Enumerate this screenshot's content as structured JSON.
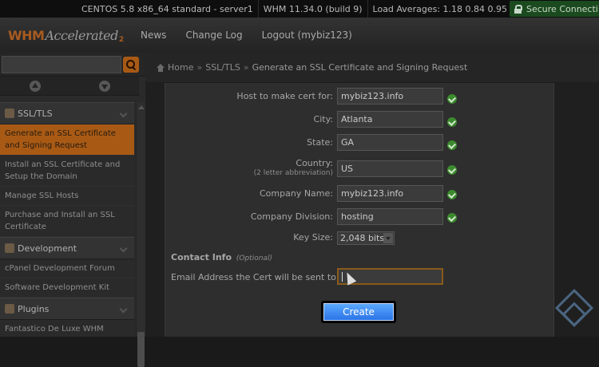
{
  "statusbar": {
    "server": "CENTOS 5.8 x86_64 standard - server1",
    "whm_version": "WHM 11.34.0 (build 9)",
    "load": "Load Averages: 1.18 0.84 0.95",
    "secure": "Secure Connecti"
  },
  "topnav": {
    "logo_main": "WHM",
    "logo_accent": "Accelerated",
    "logo_sub": "2",
    "links": [
      "News",
      "Change Log",
      "Logout (mybiz123)"
    ]
  },
  "sidebar": {
    "sections": {
      "ssl": "SSL/TLS",
      "development": "Development",
      "plugins": "Plugins"
    },
    "items": {
      "generate_ssl": "Generate an SSL Certificate and Signing Request",
      "install_ssl": "Install an SSL Certificate and Setup the Domain",
      "manage_ssl": "Manage SSL Hosts",
      "purchase_ssl": "Purchase and Install an SSL Certificate",
      "cpanel_forum": "cPanel Development Forum",
      "sdk": "Software Development Kit",
      "fantastico": "Fantastico De Luxe WHM Admin"
    }
  },
  "breadcrumb": {
    "home": "Home",
    "section": "SSL/TLS",
    "current": "Generate an SSL Certificate and Signing Request",
    "separator": "»"
  },
  "form": {
    "host_label": "Host to make cert for:",
    "host_value": "mybiz123.info",
    "city_label": "City:",
    "city_value": "Atlanta",
    "state_label": "State:",
    "state_value": "GA",
    "country_label": "Country:",
    "country_sub": "(2 letter abbreviation)",
    "country_value": "US",
    "company_label": "Company Name:",
    "company_value": "mybiz123.info",
    "division_label": "Company Division:",
    "division_value": "hosting",
    "keysize_label": "Key Size:",
    "keysize_value": "2,048 bits",
    "contact_heading": "Contact Info",
    "contact_optional": "(Optional)",
    "email_label": "Email Address the Cert will be sent to:",
    "email_value": "",
    "create_button": "Create"
  }
}
